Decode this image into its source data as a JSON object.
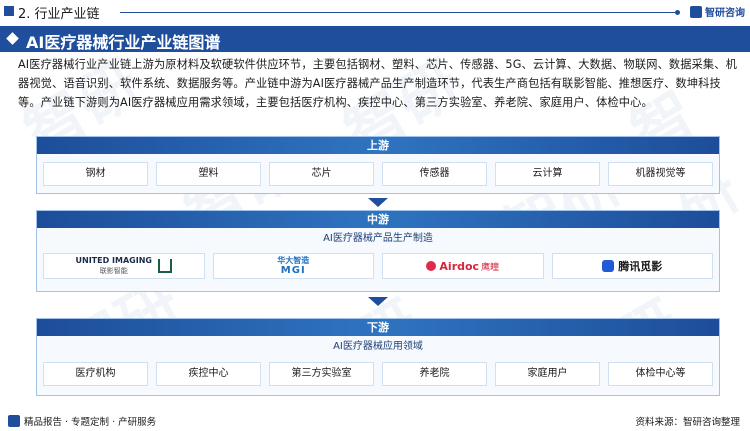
{
  "header": {
    "section": "2. 行业产业链",
    "brand": "智研咨询"
  },
  "title": "AI医疗器械行业产业链图谱",
  "intro": "AI医疗器械行业产业链上游为原材料及软硬软件供应环节，主要包括钢材、塑料、芯片、传感器、5G、云计算、大数据、物联网、数据采集、机器视觉、语音识别、软件系统、数据服务等。产业链中游为AI医疗器械产品生产制造环节，代表生产商包括有联影智能、推想医疗、数坤科技等。产业链下游则为AI医疗器械应用需求领域，主要包括医疗机构、疾控中心、第三方实验室、养老院、家庭用户、体检中心。",
  "upstream": {
    "title": "上游",
    "items": [
      "钢材",
      "塑料",
      "芯片",
      "传感器",
      "云计算",
      "机器视觉等"
    ]
  },
  "midstream": {
    "title": "中游",
    "subtitle": "AI医疗器械产品生产制造",
    "companies": [
      {
        "name": "UNITED IMAGING",
        "sub": "联影智能"
      },
      {
        "name": "华大智造",
        "sub": "MGI"
      },
      {
        "name": "Airdoc",
        "sub": "鹰瞳"
      },
      {
        "name": "腾讯觅影",
        "sub": ""
      }
    ]
  },
  "downstream": {
    "title": "下游",
    "subtitle": "AI医疗器械应用领域",
    "items": [
      "医疗机构",
      "疾控中心",
      "第三方实验室",
      "养老院",
      "家庭用户",
      "体检中心等"
    ]
  },
  "footer": {
    "left": "精品报告 · 专题定制 · 产研服务",
    "right": "资料来源：智研咨询整理"
  },
  "colors": {
    "primary": "#1f4e9c",
    "accent": "#2f74c0",
    "panel": "#f6fafe"
  }
}
